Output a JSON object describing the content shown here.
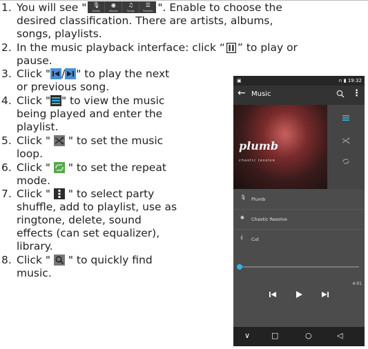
{
  "instructions": {
    "i1": {
      "num": "1.",
      "a": "You will see \"",
      "b": "\". Enable to choose the",
      "c": "desired classification. There are artists, albums,",
      "d": "songs, playlists."
    },
    "i2": {
      "num": "2.",
      "a": "In the music playback interface: click “",
      "b": "” to play or",
      "c": "pause."
    },
    "i3": {
      "num": "3.",
      "a": "Click \"",
      "sep": "/",
      "b": "\" to play the next",
      "c": "or previous song."
    },
    "i4": {
      "num": "4.",
      "a": "Click \"",
      "b": "\" to view the music",
      "c": "being played and enter the",
      "d": "playlist."
    },
    "i5": {
      "num": "5.",
      "a": "Click \" ",
      "b": " \" to set the music",
      "c": "loop."
    },
    "i6": {
      "num": "6.",
      "a": "Click \" ",
      "b": " \" to set the repeat",
      "c": "mode."
    },
    "i7": {
      "num": "7.",
      "a": "Click \" ",
      "b": " \" to select party",
      "c": "shuffle, add to playlist, use as",
      "d": "ringtone,      delete,      sound",
      "e": "effects (can set equalizer),",
      "f": "library."
    },
    "i8": {
      "num": "8.",
      "a": "Click \" ",
      "b": " \" to quickly find",
      "c": "music."
    }
  },
  "tab_strip": [
    "Artists",
    "Albums",
    "Songs",
    "Playlists"
  ],
  "phone": {
    "status_time": "19:32",
    "title": "Music",
    "album_brand": "plumb",
    "album_subtitle": "chaotic resolve",
    "artist": "Plumb",
    "album": "Chaotic Resolve",
    "song": "Cut",
    "duration": "4:01"
  },
  "colors": {
    "accent": "#33b5e5",
    "phone_bg": "#4c4c4c",
    "action_bar": "#333333"
  }
}
